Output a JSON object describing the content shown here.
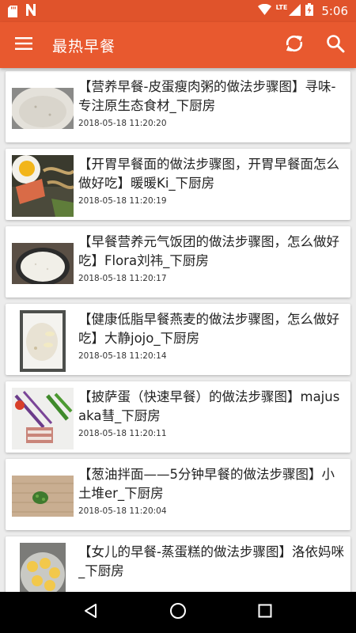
{
  "status_bar": {
    "left_icons": [
      "sd-card-icon",
      "n-notification-icon"
    ],
    "right_icons": [
      "wifi-icon",
      "lte-signal-icon",
      "battery-charging-icon"
    ],
    "network_label": "LTE",
    "time": "5:06"
  },
  "app_bar": {
    "menu_icon": "menu-icon",
    "title": "最热早餐",
    "refresh_icon": "refresh-icon",
    "search_icon": "search-icon"
  },
  "recipes": [
    {
      "title": "【营养早餐-皮蛋瘦肉粥的做法步骤图】寻味-专注原生态食材_下厨房",
      "time": "2018-05-18 11:20:20"
    },
    {
      "title": "【开胃早餐面的做法步骤图，开胃早餐面怎么做好吃】暖暖Ki_下厨房",
      "time": "2018-05-18 11:20:19"
    },
    {
      "title": "【早餐营养元气饭团的做法步骤图，怎么做好吃】Flora刘祎_下厨房",
      "time": "2018-05-18 11:20:17"
    },
    {
      "title": "【健康低脂早餐燕麦的做法步骤图，怎么做好吃】大静jojo_下厨房",
      "time": "2018-05-18 11:20:14"
    },
    {
      "title": "【披萨蛋（快速早餐）的做法步骤图】majusaka彗_下厨房",
      "time": "2018-05-18 11:20:11"
    },
    {
      "title": "【葱油拌面——5分钟早餐的做法步骤图】小土堆er_下厨房",
      "time": "2018-05-18 11:20:04"
    },
    {
      "title": "【女儿的早餐-蒸蛋糕的做法步骤图】洛依妈咪_下厨房",
      "time": ""
    }
  ],
  "nav_bar": {
    "back_icon": "back-icon",
    "home_icon": "home-icon",
    "recents_icon": "recents-icon"
  },
  "colors": {
    "status_bar": "#e0532b",
    "app_bar": "#e8592f",
    "background": "#ececec"
  }
}
